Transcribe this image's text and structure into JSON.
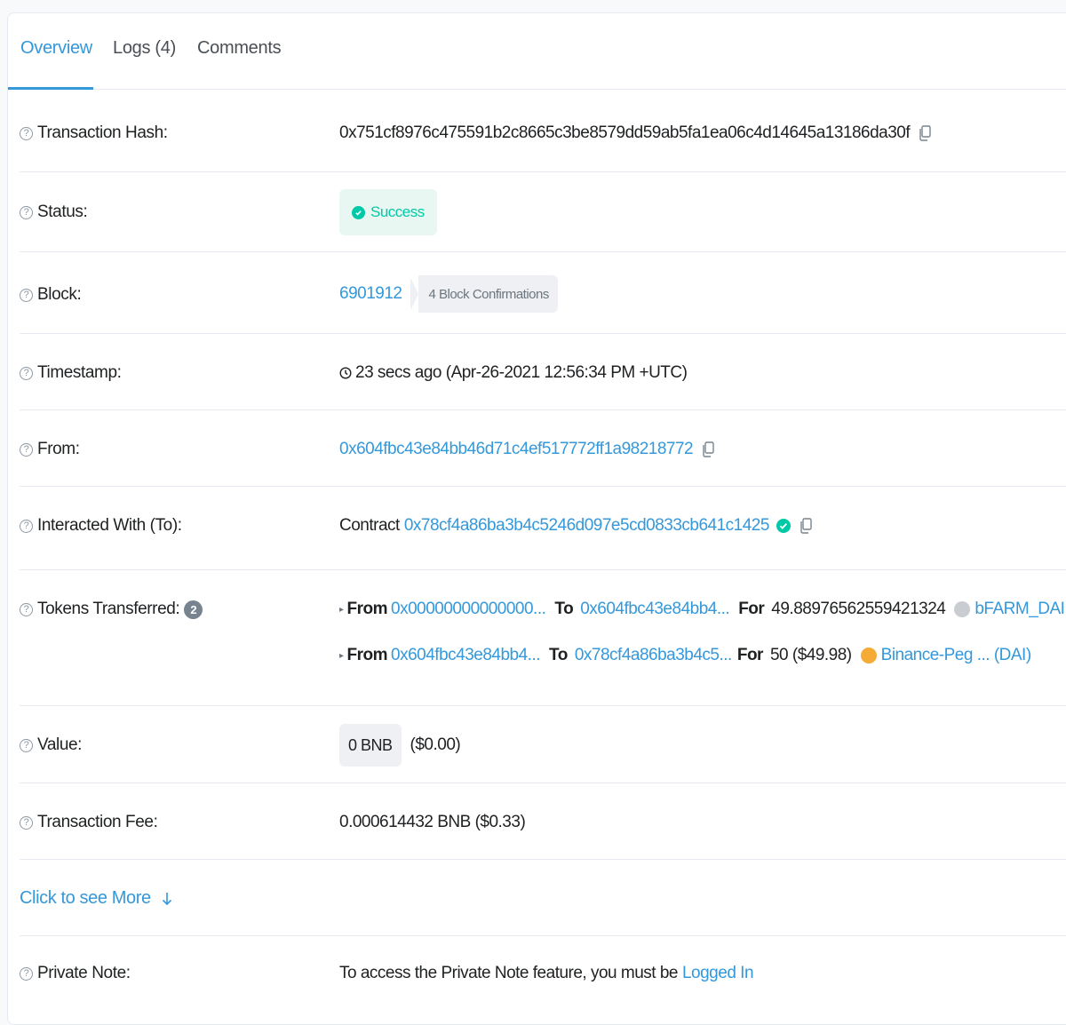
{
  "tabs": [
    {
      "label": "Overview"
    },
    {
      "label": "Logs (4)"
    },
    {
      "label": "Comments"
    }
  ],
  "rows": {
    "tx_hash": {
      "label": "Transaction Hash:",
      "value": "0x751cf8976c475591b2c8665c3be8579dd59ab5fa1ea06c4d14645a13186da30f"
    },
    "status": {
      "label": "Status:",
      "value": "Success"
    },
    "block": {
      "label": "Block:",
      "value": "6901912",
      "confirmations": "4 Block Confirmations"
    },
    "timestamp": {
      "label": "Timestamp:",
      "value": "23 secs ago (Apr-26-2021 12:56:34 PM +UTC)"
    },
    "from": {
      "label": "From:",
      "value": "0x604fbc43e84bb46d71c4ef517772ff1a98218772"
    },
    "to": {
      "label": "Interacted With (To):",
      "prefix": "Contract",
      "value": "0x78cf4a86ba3b4c5246d097e5cd0833cb641c1425"
    },
    "tokens": {
      "label": "Tokens Transferred:",
      "count": "2",
      "transfers": [
        {
          "from_label": "From",
          "from": "0x00000000000000...",
          "to_label": "To",
          "to": "0x604fbc43e84bb4...",
          "for_label": "For",
          "amount": "49.889765625594213​24",
          "token": "bFARM_DAI (bfDAI)",
          "token_color": "#c9ccd1"
        },
        {
          "from_label": "From",
          "from": "0x604fbc43e84bb4...",
          "to_label": "To",
          "to": "0x78cf4a86ba3b4c5...",
          "for_label": "For",
          "amount": "50 ($49.98)",
          "token": "Binance-Peg ... (DAI)",
          "token_color": "#f5ac37"
        }
      ]
    },
    "value": {
      "label": "Value:",
      "value": "0 BNB",
      "usd": "($0.00)"
    },
    "fee": {
      "label": "Transaction Fee:",
      "value": "0.000614432 BNB ($0.33)"
    },
    "see_more": {
      "label": "Click to see More"
    },
    "note": {
      "label": "Private Note:",
      "text": "To access the Private Note feature, you must be",
      "link": "Logged In"
    }
  },
  "colors": {
    "accent": "#3498db",
    "success": "#00c9a7"
  }
}
